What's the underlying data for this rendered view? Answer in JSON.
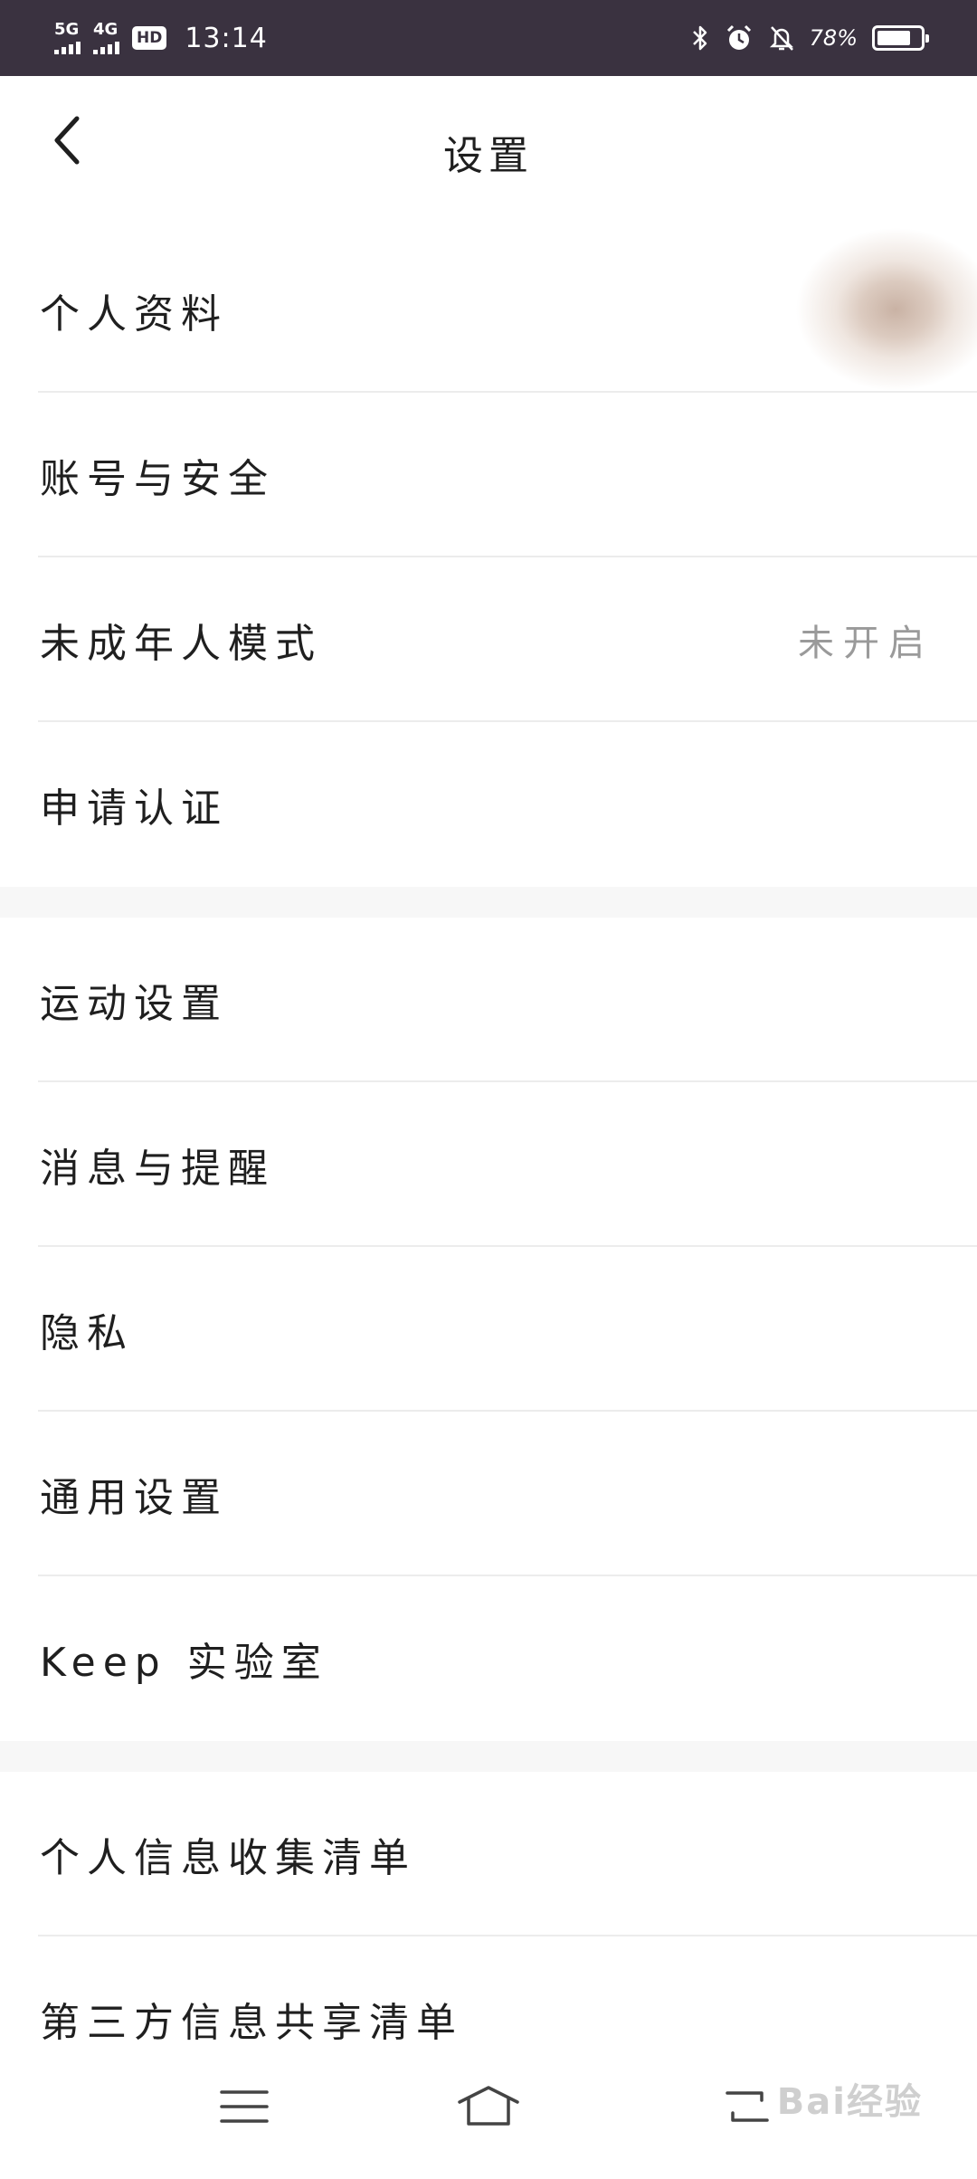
{
  "status_bar": {
    "network_1": "5G",
    "network_2": "4G",
    "hd_badge": "HD",
    "time": "13:14",
    "battery_text": "78%",
    "battery_level": 0.78,
    "icons": [
      "bluetooth-icon",
      "alarm-icon",
      "silent-bell-icon",
      "battery-icon"
    ]
  },
  "header": {
    "title": "设置",
    "back_icon": "chevron-left-icon"
  },
  "sections": [
    {
      "items": [
        {
          "label": "个人资料",
          "value": "",
          "has_avatar": true
        },
        {
          "label": "账号与安全",
          "value": ""
        },
        {
          "label": "未成年人模式",
          "value": "未开启"
        },
        {
          "label": "申请认证",
          "value": ""
        }
      ]
    },
    {
      "items": [
        {
          "label": "运动设置",
          "value": ""
        },
        {
          "label": "消息与提醒",
          "value": ""
        },
        {
          "label": "隐私",
          "value": ""
        },
        {
          "label": "通用设置",
          "value": ""
        },
        {
          "label": "Keep 实验室",
          "value": ""
        }
      ]
    },
    {
      "items": [
        {
          "label": "个人信息收集清单",
          "value": ""
        },
        {
          "label": "第三方信息共享清单",
          "value": ""
        }
      ]
    }
  ],
  "nav_bar": {
    "icons": [
      "menu-icon",
      "home-icon",
      "back-icon"
    ]
  },
  "watermark": "Bai经验"
}
